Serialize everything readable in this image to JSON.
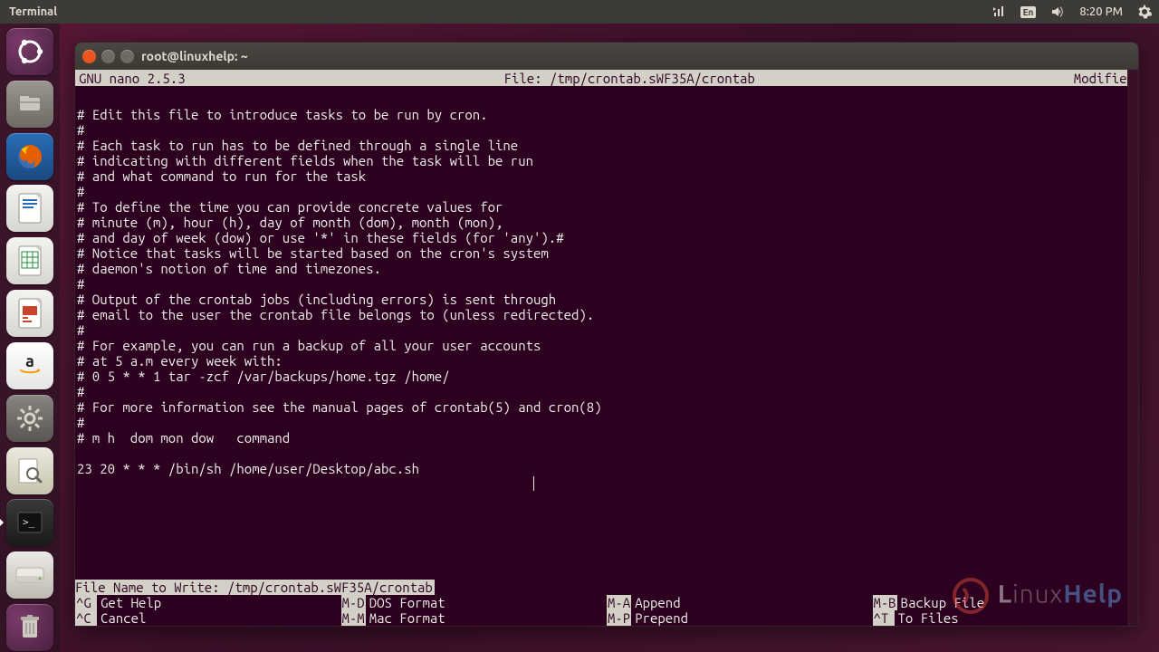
{
  "top_panel": {
    "title": "Terminal",
    "keyboard_indicator": "En",
    "time": "8:20 PM"
  },
  "launcher": {
    "items": [
      {
        "name": "ubuntu-dash",
        "label": "Dash"
      },
      {
        "name": "files",
        "label": "Files"
      },
      {
        "name": "firefox",
        "label": "Firefox"
      },
      {
        "name": "libreoffice-writer",
        "label": "LibreOffice Writer"
      },
      {
        "name": "libreoffice-calc",
        "label": "LibreOffice Calc"
      },
      {
        "name": "libreoffice-impress",
        "label": "LibreOffice Impress"
      },
      {
        "name": "amazon",
        "label": "Amazon"
      },
      {
        "name": "system-settings",
        "label": "System Settings"
      },
      {
        "name": "search-lens",
        "label": "Search"
      },
      {
        "name": "terminal",
        "label": "Terminal",
        "active": true
      },
      {
        "name": "external-drive",
        "label": "Drive"
      },
      {
        "name": "trash",
        "label": "Trash"
      }
    ]
  },
  "terminal": {
    "title": "root@linuxhelp: ~",
    "nano": {
      "version": "GNU nano 2.5.3",
      "file_label": "File: /tmp/crontab.sWF35A/crontab",
      "status": "Modified",
      "content_lines": [
        "# Edit this file to introduce tasks to be run by cron.",
        "#",
        "# Each task to run has to be defined through a single line",
        "# indicating with different fields when the task will be run",
        "# and what command to run for the task",
        "#",
        "# To define the time you can provide concrete values for",
        "# minute (m), hour (h), day of month (dom), month (mon),",
        "# and day of week (dow) or use '*' in these fields (for 'any').#",
        "# Notice that tasks will be started based on the cron's system",
        "# daemon's notion of time and timezones.",
        "#",
        "# Output of the crontab jobs (including errors) is sent through",
        "# email to the user the crontab file belongs to (unless redirected).",
        "#",
        "# For example, you can run a backup of all your user accounts",
        "# at 5 a.m every week with:",
        "# 0 5 * * 1 tar -zcf /var/backups/home.tgz /home/",
        "#",
        "# For more information see the manual pages of crontab(5) and cron(8)",
        "#",
        "# m h  dom mon dow   command",
        "",
        "23 20 * * * /bin/sh /home/user/Desktop/abc.sh"
      ],
      "cursor": {
        "col": 56,
        "row": 25
      },
      "prompt": "File Name to Write: /tmp/crontab.sWF35A/crontab",
      "shortcuts_row1": [
        {
          "key": "^G",
          "desc": "Get Help"
        },
        {
          "key": "M-D",
          "desc": "DOS Format"
        },
        {
          "key": "M-A",
          "desc": "Append"
        },
        {
          "key": "M-B",
          "desc": "Backup File"
        }
      ],
      "shortcuts_row2": [
        {
          "key": "^C",
          "desc": "Cancel"
        },
        {
          "key": "M-M",
          "desc": "Mac Format"
        },
        {
          "key": "M-P",
          "desc": "Prepend"
        },
        {
          "key": "^T",
          "desc": "To Files"
        }
      ]
    }
  },
  "watermark": {
    "text_prefix": "L",
    "text_mid": "inux",
    "text_suffix": "Help"
  }
}
